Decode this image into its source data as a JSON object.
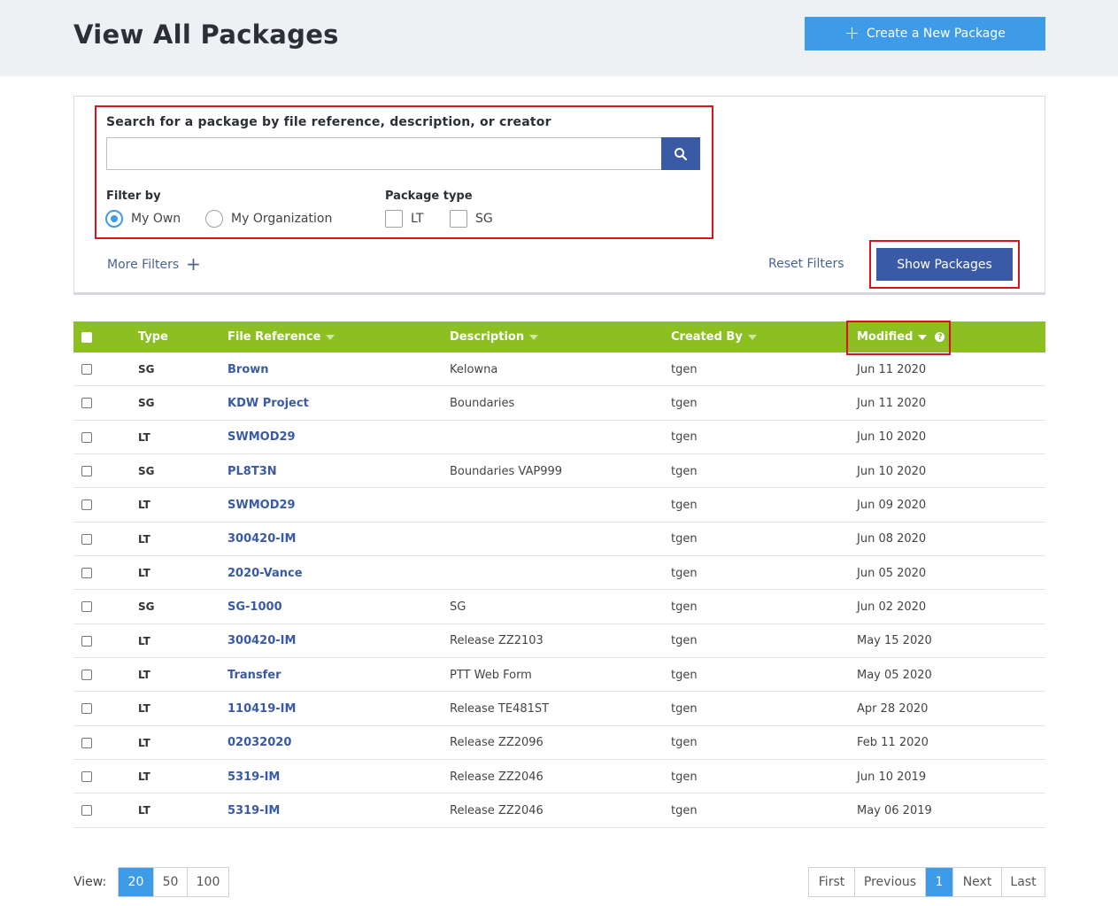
{
  "header": {
    "title": "View All Packages",
    "create_button": "Create a New Package"
  },
  "search": {
    "label": "Search for a package by file reference, description, or creator",
    "value": "",
    "placeholder": ""
  },
  "filter_by": {
    "label": "Filter by",
    "options": [
      {
        "label": "My Own",
        "selected": true
      },
      {
        "label": "My Organization",
        "selected": false
      }
    ]
  },
  "package_type": {
    "label": "Package type",
    "options": [
      {
        "label": "LT",
        "checked": false
      },
      {
        "label": "SG",
        "checked": false
      }
    ]
  },
  "actions": {
    "more_filters": "More Filters",
    "reset_filters": "Reset Filters",
    "show_packages": "Show Packages"
  },
  "table": {
    "columns": [
      "Type",
      "File Reference",
      "Description",
      "Created By",
      "Modified"
    ],
    "rows": [
      {
        "type": "SG",
        "ref": "Brown",
        "desc": "Kelowna",
        "by": "tgen",
        "modified": "Jun 11 2020"
      },
      {
        "type": "SG",
        "ref": "KDW Project",
        "desc": "Boundaries",
        "by": "tgen",
        "modified": "Jun 11 2020"
      },
      {
        "type": "LT",
        "ref": "SWMOD29",
        "desc": "",
        "by": "tgen",
        "modified": "Jun 10 2020"
      },
      {
        "type": "SG",
        "ref": "PL8T3N",
        "desc": "Boundaries VAP999",
        "by": "tgen",
        "modified": "Jun 10 2020"
      },
      {
        "type": "LT",
        "ref": "SWMOD29",
        "desc": "",
        "by": "tgen",
        "modified": "Jun 09 2020"
      },
      {
        "type": "LT",
        "ref": "300420-IM",
        "desc": "",
        "by": "tgen",
        "modified": "Jun 08 2020"
      },
      {
        "type": "LT",
        "ref": "2020-Vance",
        "desc": "",
        "by": "tgen",
        "modified": "Jun 05 2020"
      },
      {
        "type": "SG",
        "ref": "SG-1000",
        "desc": "SG",
        "by": "tgen",
        "modified": "Jun 02 2020"
      },
      {
        "type": "LT",
        "ref": "300420-IM",
        "desc": "Release ZZ2103",
        "by": "tgen",
        "modified": "May 15 2020"
      },
      {
        "type": "LT",
        "ref": "Transfer",
        "desc": "PTT Web Form",
        "by": "tgen",
        "modified": "May 05 2020"
      },
      {
        "type": "LT",
        "ref": "110419-IM",
        "desc": "Release TE481ST",
        "by": "tgen",
        "modified": "Apr 28 2020"
      },
      {
        "type": "LT",
        "ref": "02032020",
        "desc": "Release ZZ2096",
        "by": "tgen",
        "modified": "Feb 11 2020"
      },
      {
        "type": "LT",
        "ref": "5319-IM",
        "desc": "Release ZZ2046",
        "by": "tgen",
        "modified": "Jun 10 2019"
      },
      {
        "type": "LT",
        "ref": "5319-IM",
        "desc": "Release ZZ2046",
        "by": "tgen",
        "modified": "May 06 2019"
      }
    ]
  },
  "footer": {
    "view_label": "View:",
    "page_sizes": [
      "20",
      "50",
      "100"
    ],
    "active_page_size": "20",
    "pagination": [
      "First",
      "Previous",
      "1",
      "Next",
      "Last"
    ],
    "current_page": "1"
  },
  "colors": {
    "accent_blue": "#3e9be8",
    "navy": "#3a5aa6",
    "table_header_green": "#8bbf22",
    "highlight_red": "#d9121b"
  }
}
